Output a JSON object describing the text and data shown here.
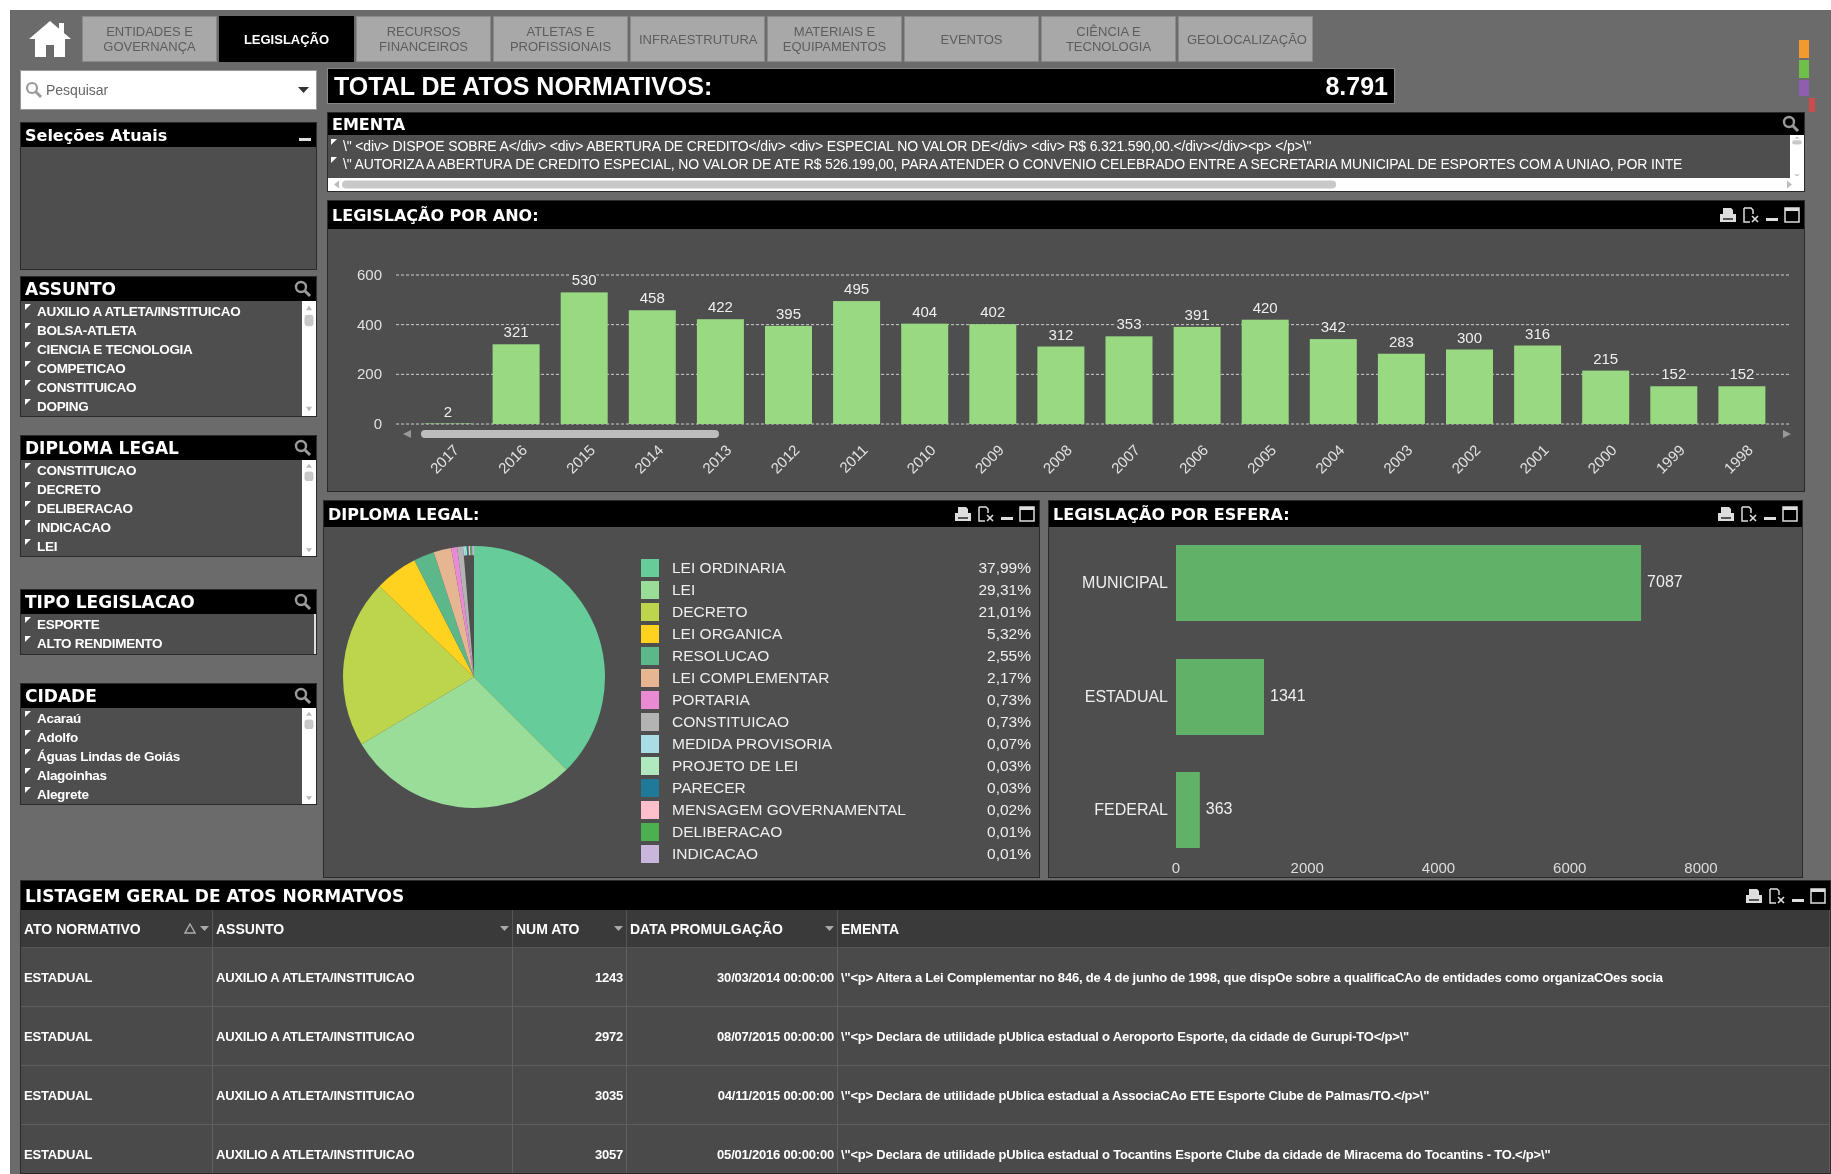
{
  "tabs": [
    {
      "label": "ENTIDADES E GOVERNANÇA",
      "selected": false
    },
    {
      "label": "LEGISLAÇÃO",
      "selected": true
    },
    {
      "label": "RECURSOS FINANCEIROS",
      "selected": false
    },
    {
      "label": "ATLETAS E PROFISSIONAIS",
      "selected": false
    },
    {
      "label": "INFRAESTRUTURA",
      "selected": false
    },
    {
      "label": "MATERIAIS E EQUIPAMENTOS",
      "selected": false
    },
    {
      "label": "EVENTOS",
      "selected": false
    },
    {
      "label": "CIÊNCIA E TECNOLOGIA",
      "selected": false
    },
    {
      "label": "GEOLOCALIZAÇÃO",
      "selected": false
    }
  ],
  "search": {
    "placeholder": "Pesquisar"
  },
  "total": {
    "label": "TOTAL DE ATOS NORMATIVOS:",
    "value": "8.791"
  },
  "current_selections": {
    "title": "Seleções Atuais"
  },
  "list_boxes": [
    {
      "title": "ASSUNTO",
      "scrollable": true,
      "items": [
        "AUXILIO A ATLETA/INSTITUICAO",
        "BOLSA-ATLETA",
        "CIENCIA E TECNOLOGIA",
        "COMPETICAO",
        "CONSTITUICAO",
        "DOPING"
      ]
    },
    {
      "title": "DIPLOMA LEGAL",
      "scrollable": true,
      "items": [
        "CONSTITUICAO",
        "DECRETO",
        "DELIBERACAO",
        "INDICACAO",
        "LEI"
      ]
    },
    {
      "title": "TIPO LEGISLACAO",
      "scrollable": false,
      "items": [
        "ESPORTE",
        "ALTO RENDIMENTO"
      ]
    },
    {
      "title": "CIDADE",
      "scrollable": true,
      "items": [
        "Acaraú",
        "Adolfo",
        "Águas Lindas de Goiás",
        "Alagoinhas",
        "Alegrete"
      ]
    }
  ],
  "ementa": {
    "title": "EMENTA",
    "rows": [
      "\\\" <div>  DISPOE SOBRE A</div> <div>  ABERTURA DE CREDITO</div> <div>  ESPECIAL NO VALOR DE</div> <div>  R$ 6.321.590,00.</div></div><p>  </p>\\\"",
      "\\\" AUTORIZA A ABERTURA DE CREDITO ESPECIAL, NO VALOR DE ATE R$ 526.199,00, PARA ATENDER O CONVENIO CELEBRADO ENTRE A SECRETARIA MUNICIPAL DE ESPORTES COM A UNIAO, POR INTE"
    ]
  },
  "year_chart": {
    "title": "LEGISLAÇÃO POR ANO:",
    "chart_data": {
      "type": "bar",
      "categories": [
        "2017",
        "2016",
        "2015",
        "2014",
        "2013",
        "2012",
        "2011",
        "2010",
        "2009",
        "2008",
        "2007",
        "2006",
        "2005",
        "2004",
        "2003",
        "2002",
        "2001",
        "2000",
        "1999",
        "1998"
      ],
      "values": [
        2,
        321,
        530,
        458,
        422,
        395,
        495,
        404,
        402,
        312,
        353,
        391,
        420,
        342,
        283,
        300,
        316,
        215,
        152,
        152
      ],
      "ylim": [
        0,
        600
      ],
      "yticks": [
        0,
        200,
        400,
        600
      ],
      "data_labels": true
    }
  },
  "diploma_chart": {
    "title": "DIPLOMA LEGAL:",
    "chart_data": {
      "type": "pie",
      "categories": [
        "LEI ORDINARIA",
        "LEI",
        "DECRETO",
        "LEI ORGANICA",
        "RESOLUCAO",
        "LEI COMPLEMENTAR",
        "PORTARIA",
        "CONSTITUICAO",
        "MEDIDA PROVISORIA",
        "PROJETO DE LEI",
        "PARECER",
        "MENSAGEM GOVERNAMENTAL",
        "DELIBERACAO",
        "INDICACAO"
      ],
      "values": [
        37.99,
        29.31,
        21.01,
        5.32,
        2.55,
        2.17,
        0.73,
        0.73,
        0.07,
        0.03,
        0.03,
        0.02,
        0.01,
        0.01
      ]
    },
    "legend": [
      {
        "share": "37,99%",
        "color": "#66cc99"
      },
      {
        "share": "29,31%",
        "color": "#99dd99"
      },
      {
        "share": "21,01%",
        "color": "#bcd54c"
      },
      {
        "share": "5,32%",
        "color": "#ffd21f"
      },
      {
        "share": "2,55%",
        "color": "#5cb88a"
      },
      {
        "share": "2,17%",
        "color": "#e6b591"
      },
      {
        "share": "0,73%",
        "color": "#e88bd4"
      },
      {
        "share": "0,73%",
        "color": "#b3b3b3"
      },
      {
        "share": "0,07%",
        "color": "#a9dce3"
      },
      {
        "share": "0,03%",
        "color": "#b0e8c0"
      },
      {
        "share": "0,03%",
        "color": "#1f7a99"
      },
      {
        "share": "0,02%",
        "color": "#ffc0cb"
      },
      {
        "share": "0,01%",
        "color": "#4caf50"
      },
      {
        "share": "0,01%",
        "color": "#c8b6dc"
      }
    ]
  },
  "sphere_chart": {
    "title": "LEGISLAÇÃO POR ESFERA:",
    "chart_data": {
      "type": "bar",
      "orientation": "horizontal",
      "categories": [
        "MUNICIPAL",
        "ESTADUAL",
        "FEDERAL"
      ],
      "values": [
        7087,
        1341,
        363
      ],
      "xlim": [
        0,
        8000
      ],
      "xticks": [
        0,
        2000,
        4000,
        6000,
        8000
      ],
      "data_labels": true
    }
  },
  "table": {
    "title": "LISTAGEM GERAL DE ATOS NORMATVOS",
    "columns": [
      {
        "label": "ATO NORMATIVO",
        "sorted": true,
        "menu": true
      },
      {
        "label": "ASSUNTO",
        "sorted": false,
        "menu": true
      },
      {
        "label": "NUM ATO",
        "sorted": false,
        "menu": true
      },
      {
        "label": "DATA PROMULGAÇÃO",
        "sorted": false,
        "menu": true
      },
      {
        "label": "EMENTA",
        "sorted": false,
        "menu": false
      }
    ],
    "rows": [
      [
        "ESTADUAL",
        "AUXILIO A ATLETA/INSTITUICAO",
        "1243",
        "30/03/2014 00:00:00",
        "\\\"<p> Altera a Lei Complementar no 846, de 4 de junho de 1998, que dispOe sobre a qualificaCAo de entidades como organizaCOes socia"
      ],
      [
        "ESTADUAL",
        "AUXILIO A ATLETA/INSTITUICAO",
        "2972",
        "08/07/2015 00:00:00",
        "\\\"<p> Declara de utilidade pUblica estadual o Aeroporto Esporte, da cidade de Gurupi-TO</p>\\\""
      ],
      [
        "ESTADUAL",
        "AUXILIO A ATLETA/INSTITUICAO",
        "3035",
        "04/11/2015 00:00:00",
        "\\\"<p> Declara de utilidade pUblica estadual a AssociaCAo ETE Esporte Clube de Palmas/TO.</p>\\\""
      ],
      [
        "ESTADUAL",
        "AUXILIO A ATLETA/INSTITUICAO",
        "3057",
        "05/01/2016 00:00:00",
        "\\\"<p> Declara de utilidade pUblica estadual o Tocantins Esporte Clube da cidade de Miracema do Tocantins - TO.</p>\\\""
      ]
    ]
  }
}
